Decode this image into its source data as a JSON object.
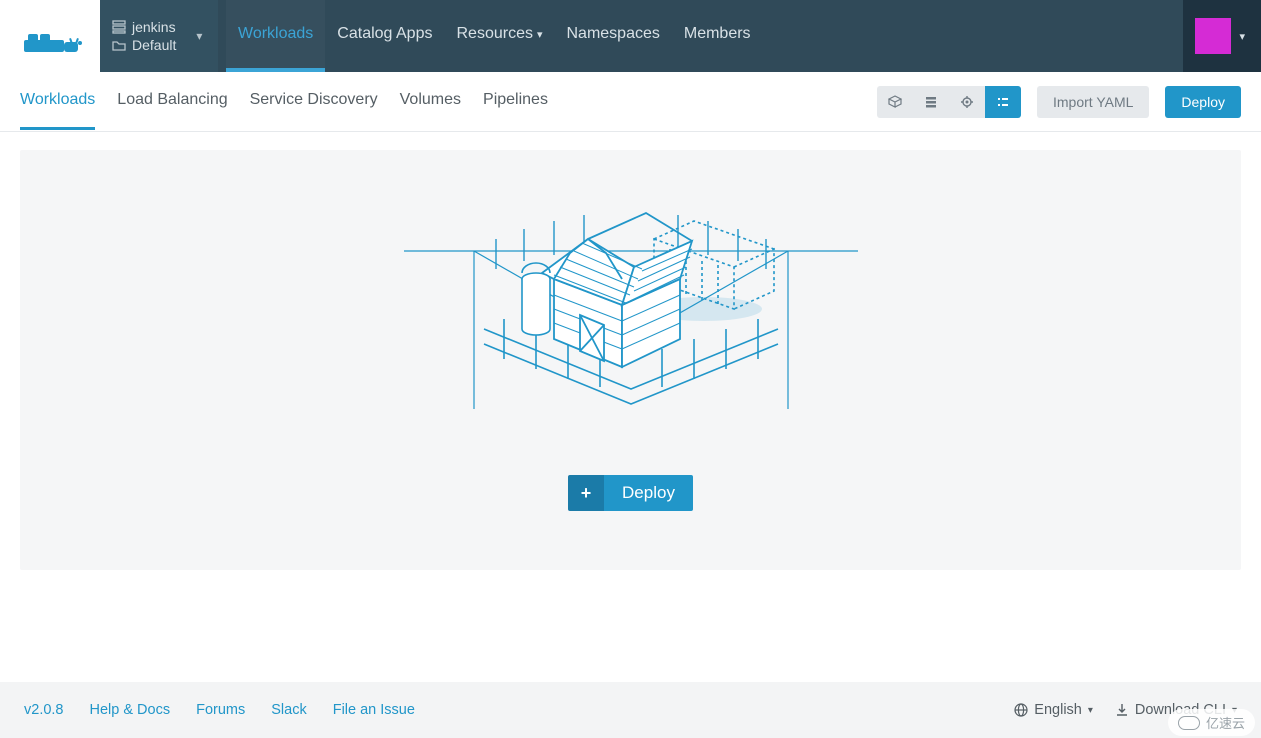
{
  "header": {
    "cluster_name": "jenkins",
    "project_name": "Default",
    "nav": [
      {
        "label": "Workloads",
        "active": true,
        "has_dropdown": false
      },
      {
        "label": "Catalog Apps",
        "active": false,
        "has_dropdown": false
      },
      {
        "label": "Resources",
        "active": false,
        "has_dropdown": true
      },
      {
        "label": "Namespaces",
        "active": false,
        "has_dropdown": false
      },
      {
        "label": "Members",
        "active": false,
        "has_dropdown": false
      }
    ]
  },
  "subnav": {
    "tabs": [
      {
        "label": "Workloads",
        "active": true
      },
      {
        "label": "Load Balancing",
        "active": false
      },
      {
        "label": "Service Discovery",
        "active": false
      },
      {
        "label": "Volumes",
        "active": false
      },
      {
        "label": "Pipelines",
        "active": false
      }
    ],
    "import_yaml_label": "Import YAML",
    "deploy_label": "Deploy"
  },
  "main": {
    "deploy_button_label": "Deploy"
  },
  "footer": {
    "version": "v2.0.8",
    "links": [
      "Help & Docs",
      "Forums",
      "Slack",
      "File an Issue"
    ],
    "language": "English",
    "download_cli": "Download CLI"
  },
  "watermark": "亿速云"
}
